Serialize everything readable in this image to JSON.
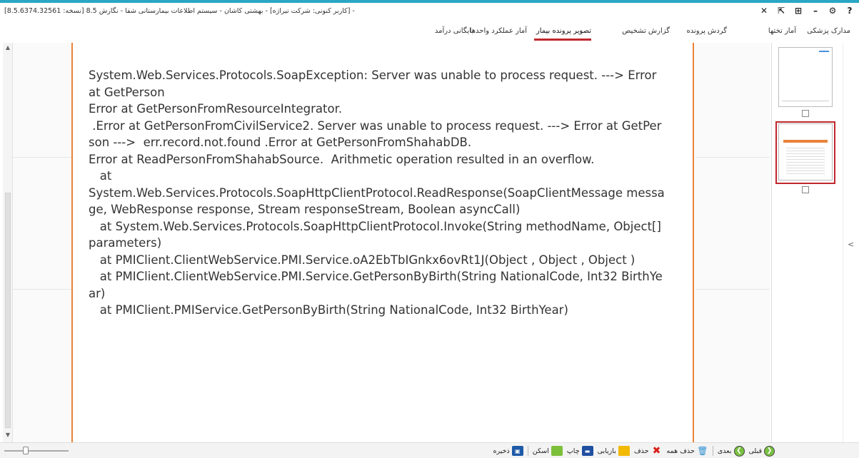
{
  "window": {
    "title": "- [کاربر کنونی: شرکت تیراژه] - بهشتی کاشان - سیستم اطلاعات بیمارستانی شفا - نگارش 8.5 [نسخه: 8.5.6374.32561]",
    "controls": [
      "?",
      "⚙",
      "–",
      "⊞",
      "⇱",
      "✕"
    ]
  },
  "tabs": [
    {
      "label": "مدارک پزشکی",
      "active": false
    },
    {
      "label": "آمار تختها",
      "active": false
    },
    {
      "label": "گردش پرونده",
      "active": false
    },
    {
      "label": "گزارش تشخیص",
      "active": false
    },
    {
      "label": "تصویر پرونده بیمار",
      "active": true
    },
    {
      "label": "آمار عملکرد واحدها",
      "active": false
    },
    {
      "label": "بایگانی درآمد",
      "active": false
    }
  ],
  "document": {
    "text": "System.Web.Services.Protocols.SoapException: Server was unable to process request. ---> Error at GetPerson\nError at GetPersonFromResourceIntegrator.\n .Error at GetPersonFromCivilService2. Server was unable to process request. ---> Error at GetPerson --->  err.record.not.found .Error at GetPersonFromShahabDB.\nError at ReadPersonFromShahabSource.  Arithmetic operation resulted in an overflow.\n   at\nSystem.Web.Services.Protocols.SoapHttpClientProtocol.ReadResponse(SoapClientMessage message, WebResponse response, Stream responseStream, Boolean asyncCall)\n   at System.Web.Services.Protocols.SoapHttpClientProtocol.Invoke(String methodName, Object[] parameters)\n   at PMIClient.ClientWebService.PMI.Service.oA2EbTbIGnkx6ovRt1J(Object , Object , Object )\n   at PMIClient.ClientWebService.PMI.Service.GetPersonByBirth(String NationalCode, Int32 BirthYear)\n   at PMIClient.PMIService.GetPersonByBirth(String NationalCode, Int32 BirthYear)"
  },
  "thumbnails": [
    {
      "selected": false,
      "checked": false
    },
    {
      "selected": true,
      "checked": false
    }
  ],
  "toolbar": {
    "save": "ذخیره",
    "scan": "اسکن",
    "print": "چاپ",
    "restore": "بازیابی",
    "delete": "حذف",
    "delete_all": "حذف همه",
    "next": "بعدی",
    "prev": "قبلی"
  },
  "colors": {
    "accent_top": "#2aa7c4",
    "active_tab_underline": "#c1272d",
    "page_border": "#e8833a"
  },
  "icons": {
    "save": "save-icon",
    "scan": "scan-icon",
    "print": "printer-icon",
    "restore": "folder-icon",
    "delete": "x-delete-icon",
    "delete_all": "trash-icon",
    "next": "arrow-next-icon",
    "prev": "arrow-prev-icon"
  }
}
